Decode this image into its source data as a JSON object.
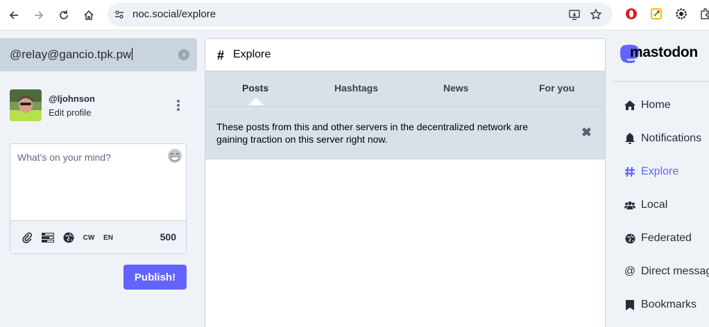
{
  "browser": {
    "url": "noc.social/explore"
  },
  "search": {
    "value": "@relay@gancio.tpk.pw"
  },
  "account": {
    "handle": "@ljohnson",
    "edit_label": "Edit profile"
  },
  "compose": {
    "placeholder": "What's on your mind?",
    "cw_label": "CW",
    "lang_label": "EN",
    "char_count": "500",
    "publish_label": "Publish!"
  },
  "column": {
    "title": "Explore",
    "tabs": [
      {
        "label": "Posts",
        "active": true
      },
      {
        "label": "Hashtags",
        "active": false
      },
      {
        "label": "News",
        "active": false
      },
      {
        "label": "For you",
        "active": false
      }
    ],
    "banner_text": "These posts from this and other servers in the decentralized network are gaining traction on this server right now."
  },
  "brand": {
    "name": "mastodon",
    "accent_color": "#6364ff"
  },
  "nav": {
    "items": [
      {
        "label": "Home",
        "icon": "home-icon"
      },
      {
        "label": "Notifications",
        "icon": "bell-icon"
      },
      {
        "label": "Explore",
        "icon": "hashtag-icon",
        "active": true
      },
      {
        "label": "Local",
        "icon": "users-icon"
      },
      {
        "label": "Federated",
        "icon": "globe-icon"
      },
      {
        "label": "Direct messages",
        "icon": "at-icon"
      },
      {
        "label": "Bookmarks",
        "icon": "bookmark-icon"
      }
    ]
  }
}
